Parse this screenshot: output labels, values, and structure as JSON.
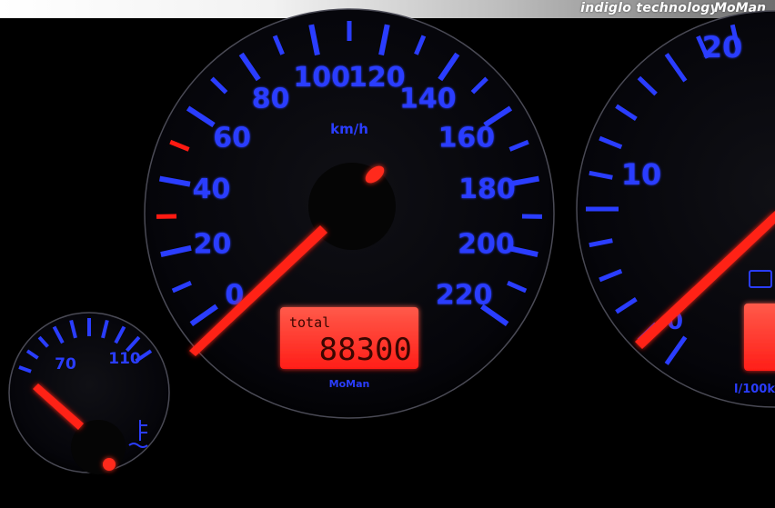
{
  "header": {
    "tagline": "indiglo technology",
    "logo": "MoMan"
  },
  "speedometer": {
    "unit": "km/h",
    "labels": [
      "0",
      "20",
      "40",
      "60",
      "80",
      "100",
      "120",
      "140",
      "160",
      "180",
      "200",
      "220"
    ],
    "odometer_label": "total",
    "odometer_value": "88300",
    "maker": "MoMan"
  },
  "tachometer": {
    "labels": [
      "0",
      "10",
      "20"
    ],
    "consumption_unit": "l/100k"
  },
  "temperature_gauge": {
    "labels": [
      "70",
      "110"
    ]
  },
  "colors": {
    "scale_blue": "#2a3dff",
    "needle_red": "#ff1a12",
    "lcd_red": "#ff3b33",
    "background": "#000000"
  }
}
